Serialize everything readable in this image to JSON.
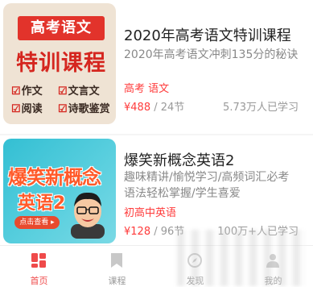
{
  "courses": [
    {
      "thumb_title": "高考语文",
      "thumb_main": "特训课程",
      "thumb_tags": [
        "作文",
        "文言文",
        "阅读",
        "诗歌鉴赏"
      ],
      "title": "2020年高考语文特训课程",
      "description": "2020年高考语文冲刺135分的秘诀",
      "tags": "高考 语文",
      "price": "¥488",
      "lessons": "/ 24节",
      "learners": "5.73万人已学习"
    },
    {
      "thumb_title": "爆笑新概念",
      "thumb_main": "英语2",
      "thumb_button": "点击查看 ▸",
      "title": "爆笑新概念英语2",
      "description": "趣味精讲/愉悦学习/高频词汇必考语法轻松掌握/学生喜爱",
      "tags": "初高中英语",
      "price": "¥128",
      "lessons": "/ 96节",
      "learners": "100万+人已学习"
    }
  ],
  "tabbar": {
    "tabs": [
      {
        "label": "首页",
        "icon": "home-grid-icon",
        "active": true
      },
      {
        "label": "课程",
        "icon": "bookmark-icon",
        "active": false
      },
      {
        "label": "发现",
        "icon": "discover-icon",
        "active": false
      },
      {
        "label": "我的",
        "icon": "profile-icon",
        "active": false
      }
    ]
  },
  "colors": {
    "accent": "#ef4a4a",
    "price": "#ff3b3b",
    "muted": "#999999"
  }
}
